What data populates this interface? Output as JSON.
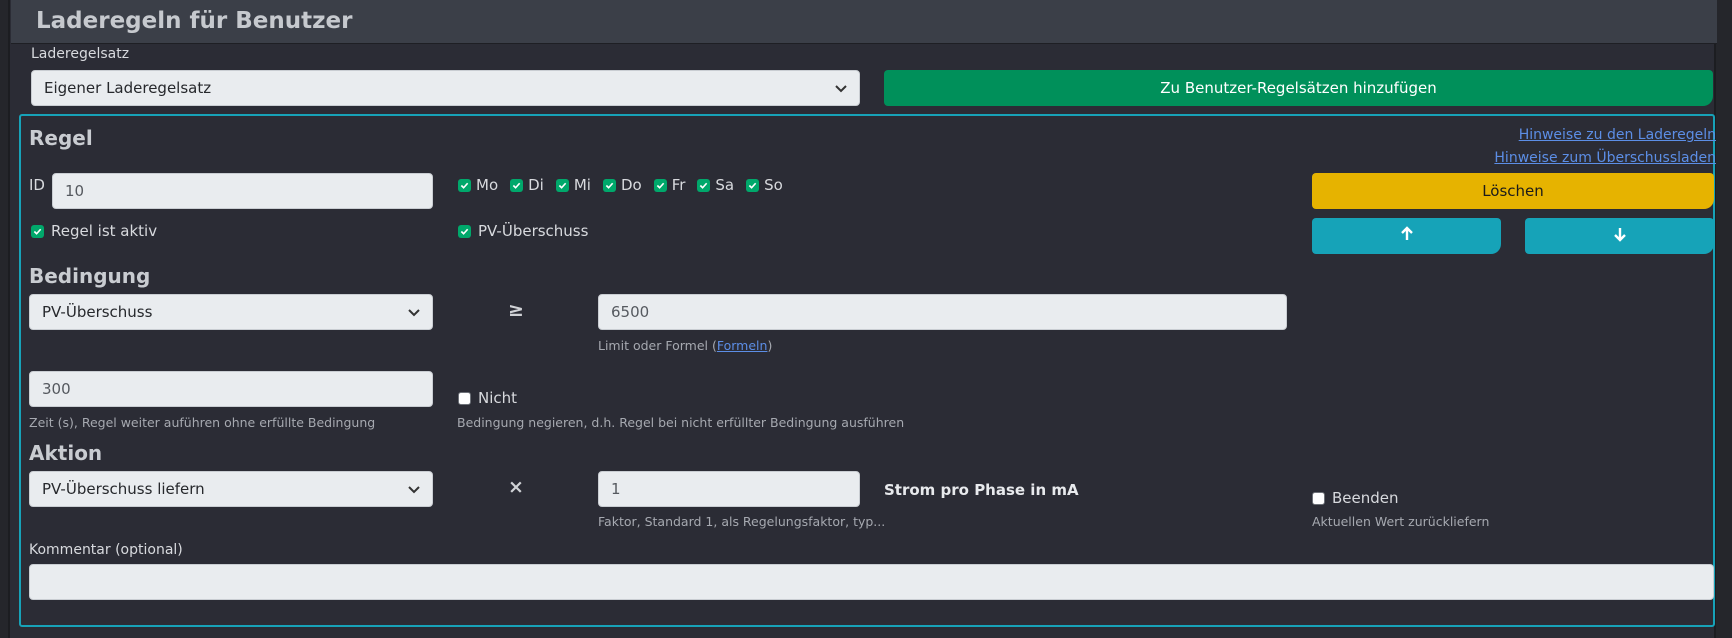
{
  "header": {
    "title": "Laderegeln für Benutzer"
  },
  "ruleset": {
    "label": "Laderegelsatz",
    "selected": "Eigener Laderegelsatz",
    "add_button": "Zu Benutzer-Regelsätzen hinzufügen"
  },
  "rule": {
    "section_title": "Regel",
    "help_link_rules": "Hinweise zu den Laderegeln",
    "help_link_surplus": "Hinweise zum Überschussladen",
    "id_label": "ID",
    "id_value": "10",
    "days": [
      {
        "label": "Mo",
        "checked": true
      },
      {
        "label": "Di",
        "checked": true
      },
      {
        "label": "Mi",
        "checked": true
      },
      {
        "label": "Do",
        "checked": true
      },
      {
        "label": "Fr",
        "checked": true
      },
      {
        "label": "Sa",
        "checked": true
      },
      {
        "label": "So",
        "checked": true
      }
    ],
    "active_label": "Regel ist aktiv",
    "pv_surplus_label": "PV-Überschuss",
    "delete_button": "Löschen",
    "up_icon": "arrow-up-icon",
    "down_icon": "arrow-down-icon"
  },
  "condition": {
    "section_title": "Bedingung",
    "type": "PV-Überschuss",
    "operator": "≥",
    "limit_value": "6500",
    "limit_help": "Limit oder Formel (",
    "limit_help_link": "Formeln",
    "limit_help_end": ")",
    "time_value": "300",
    "time_help": "Zeit (s), Regel weiter auführen ohne erfüllte Bedingung",
    "negate_label": "Nicht",
    "negate_help": "Bedingung negieren, d.h. Regel bei nicht erfüllter Bedingung ausführen"
  },
  "action": {
    "section_title": "Aktion",
    "type": "PV-Überschuss liefern",
    "operator": "×",
    "factor_value": "1",
    "factor_help": "Faktor, Standard 1, als Regelungsfaktor, typ...",
    "unit": "Strom pro Phase in mA",
    "finish_label": "Beenden",
    "finish_help": "Aktuellen Wert zurückliefern"
  },
  "comment": {
    "label": "Kommentar (optional)",
    "value": ""
  },
  "colors": {
    "accent_teal": "#17a2b8",
    "green": "#00905a",
    "yellow": "#e6b300"
  }
}
